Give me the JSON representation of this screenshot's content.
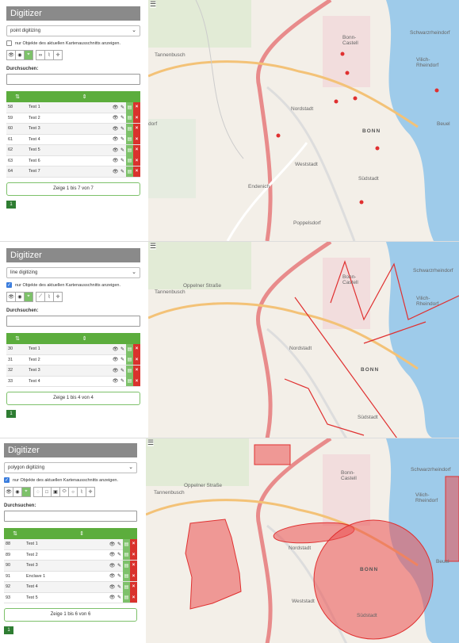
{
  "panels": [
    {
      "title": "Digitizer",
      "mode": "point digitizing",
      "checkbox_label": "nur Objekte des aktuellen Kartenausschnitts anzeigen.",
      "checkbox_checked": false,
      "search_label": "Durchsuchen:",
      "rows": [
        {
          "id": "58",
          "name": "Test 1"
        },
        {
          "id": "59",
          "name": "Test 2"
        },
        {
          "id": "60",
          "name": "Test 3"
        },
        {
          "id": "61",
          "name": "Test 4"
        },
        {
          "id": "62",
          "name": "Test 5"
        },
        {
          "id": "63",
          "name": "Test 6"
        },
        {
          "id": "64",
          "name": "Test 7"
        }
      ],
      "footer": "Zeige 1 bis 7 von 7",
      "page": "1"
    },
    {
      "title": "Digitizer",
      "mode": "line digitizing",
      "checkbox_label": "nur Objekte des aktuellen Kartenausschnitts anzeigen.",
      "checkbox_checked": true,
      "search_label": "Durchsuchen:",
      "rows": [
        {
          "id": "30",
          "name": "Test 1"
        },
        {
          "id": "31",
          "name": "Test 2"
        },
        {
          "id": "32",
          "name": "Test 3"
        },
        {
          "id": "33",
          "name": "Test 4"
        }
      ],
      "footer": "Zeige 1 bis 4 von 4",
      "page": "1"
    },
    {
      "title": "Digitizer",
      "mode": "polygon digitizing",
      "checkbox_label": "nur Objekte des aktuellen Kartenausschnitts anzeigen.",
      "checkbox_checked": true,
      "search_label": "Durchsuchen:",
      "rows": [
        {
          "id": "88",
          "name": "Test 1"
        },
        {
          "id": "89",
          "name": "Test 2"
        },
        {
          "id": "90",
          "name": "Test 3"
        },
        {
          "id": "91",
          "name": "Enclave 1"
        },
        {
          "id": "92",
          "name": "Test 4"
        },
        {
          "id": "93",
          "name": "Test 5"
        }
      ],
      "footer": "Zeige 1 bis 6 von 6",
      "page": "1"
    }
  ],
  "table_header": {
    "sort_icon": "⇅",
    "col2_icon": "⇕"
  },
  "map_labels": {
    "bonn_castell": "Bonn-\nCastell",
    "tannenbusch": "Tannenbusch",
    "nordstadt": "Nordstadt",
    "bonn": "BONN",
    "weststadt": "Weststadt",
    "suedstadt": "Südstadt",
    "endenich": "Endenich",
    "poppelsdorf": "Poppelsdorf",
    "vilich": "Vilich-\nRheindorf",
    "beuel": "Beuel",
    "schwarzrheindorf": "Schwarzrheindorf",
    "dorf": "dorf",
    "oppelner": "Oppelner Straße",
    "reuterstrasse": "Reuterstraße"
  },
  "colors": {
    "accent_green": "#5cad3d",
    "feature_red": "#e03030",
    "river": "#9ecbea"
  }
}
